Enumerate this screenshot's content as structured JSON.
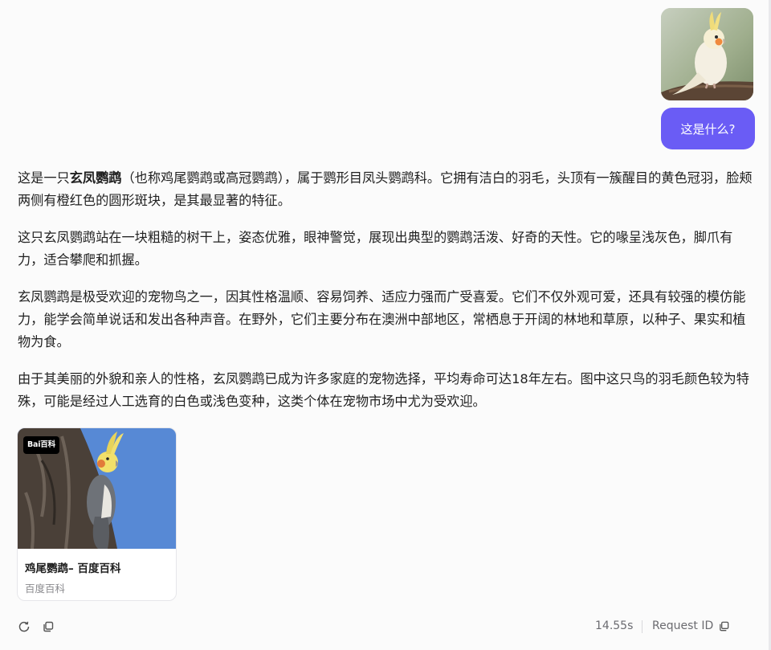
{
  "user_message": {
    "image_alt": "white cockatiel photo",
    "text": "这是什么?"
  },
  "answer": {
    "p1_before": "这是一只",
    "p1_bold": "玄凤鹦鹉",
    "p1_after": "（也称鸡尾鹦鹉或高冠鹦鹉），属于鹦形目凤头鹦鹉科。它拥有洁白的羽毛，头顶有一簇醒目的黄色冠羽，脸颊两侧有橙红色的圆形斑块，是其最显著的特征。",
    "p2": "这只玄凤鹦鹉站在一块粗糙的树干上，姿态优雅，眼神警觉，展现出典型的鹦鹉活泼、好奇的天性。它的喙呈浅灰色，脚爪有力，适合攀爬和抓握。",
    "p3": "玄凤鹦鹉是极受欢迎的宠物鸟之一，因其性格温顺、容易饲养、适应力强而广受喜爱。它们不仅外观可爱，还具有较强的模仿能力，能学会简单说话和发出各种声音。在野外，它们主要分布在澳洲中部地区，常栖息于开阔的林地和草原，以种子、果实和植物为食。",
    "p4": "由于其美丽的外貌和亲人的性格，玄凤鹦鹉已成为许多家庭的宠物选择，平均寿命可达18年左右。图中这只鸟的羽毛颜色较为特殊，可能是经过人工选育的白色或浅色变种，这类个体在宠物市场中尤为受欢迎。"
  },
  "source_card": {
    "badge": "Bai百科",
    "title": "鸡尾鹦鹉– 百度百科",
    "source": "百度百科"
  },
  "footer": {
    "latency": "14.55s",
    "request_id_label": "Request ID"
  },
  "colors": {
    "accent": "#6a5cf5",
    "background": "#fbfbfb",
    "muted_text": "#6b6b70"
  },
  "icons": [
    "refresh-icon",
    "copy-icon",
    "copy-request-id-icon"
  ]
}
